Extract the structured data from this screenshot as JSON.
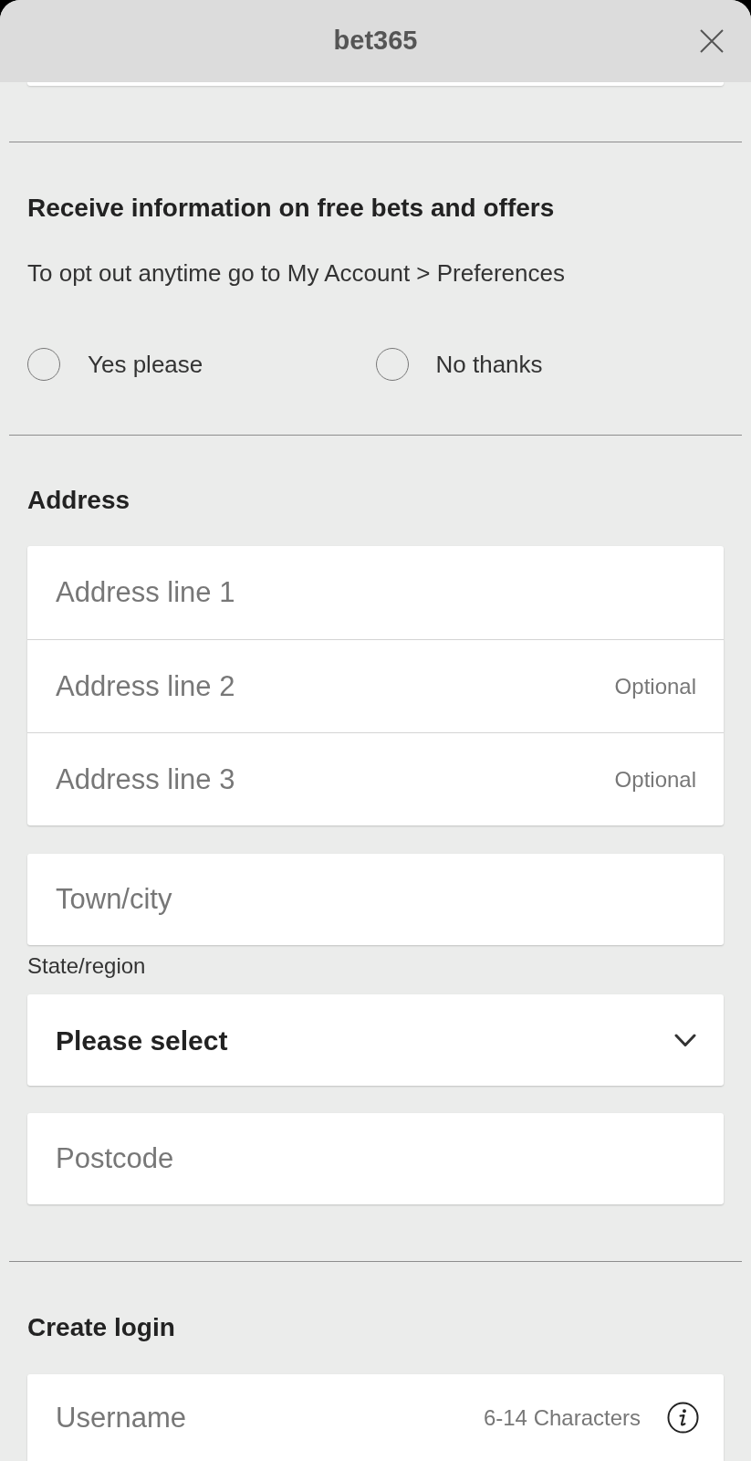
{
  "header": {
    "title": "bet365"
  },
  "offers": {
    "heading": "Receive information on free bets and offers",
    "note": "To opt out anytime go to My Account > Preferences",
    "options": [
      {
        "label": "Yes please",
        "selected": false
      },
      {
        "label": "No thanks",
        "selected": false
      }
    ]
  },
  "address": {
    "heading": "Address",
    "groups": [
      {
        "fields": [
          {
            "kind": "text",
            "placeholder": "Address line 1"
          },
          {
            "kind": "text",
            "placeholder": "Address line 2",
            "hint": "Optional"
          },
          {
            "kind": "text",
            "placeholder": "Address line 3",
            "hint": "Optional"
          }
        ]
      },
      {
        "fields": [
          {
            "kind": "text",
            "placeholder": "Town/city"
          }
        ]
      },
      {
        "label": "State/region",
        "fields": [
          {
            "kind": "select",
            "value": "Please select"
          }
        ]
      },
      {
        "fields": [
          {
            "kind": "text",
            "placeholder": "Postcode"
          }
        ]
      }
    ]
  },
  "login": {
    "heading": "Create login",
    "fields": [
      {
        "kind": "text",
        "placeholder": "Username",
        "hint": "6-14 Characters"
      }
    ]
  }
}
